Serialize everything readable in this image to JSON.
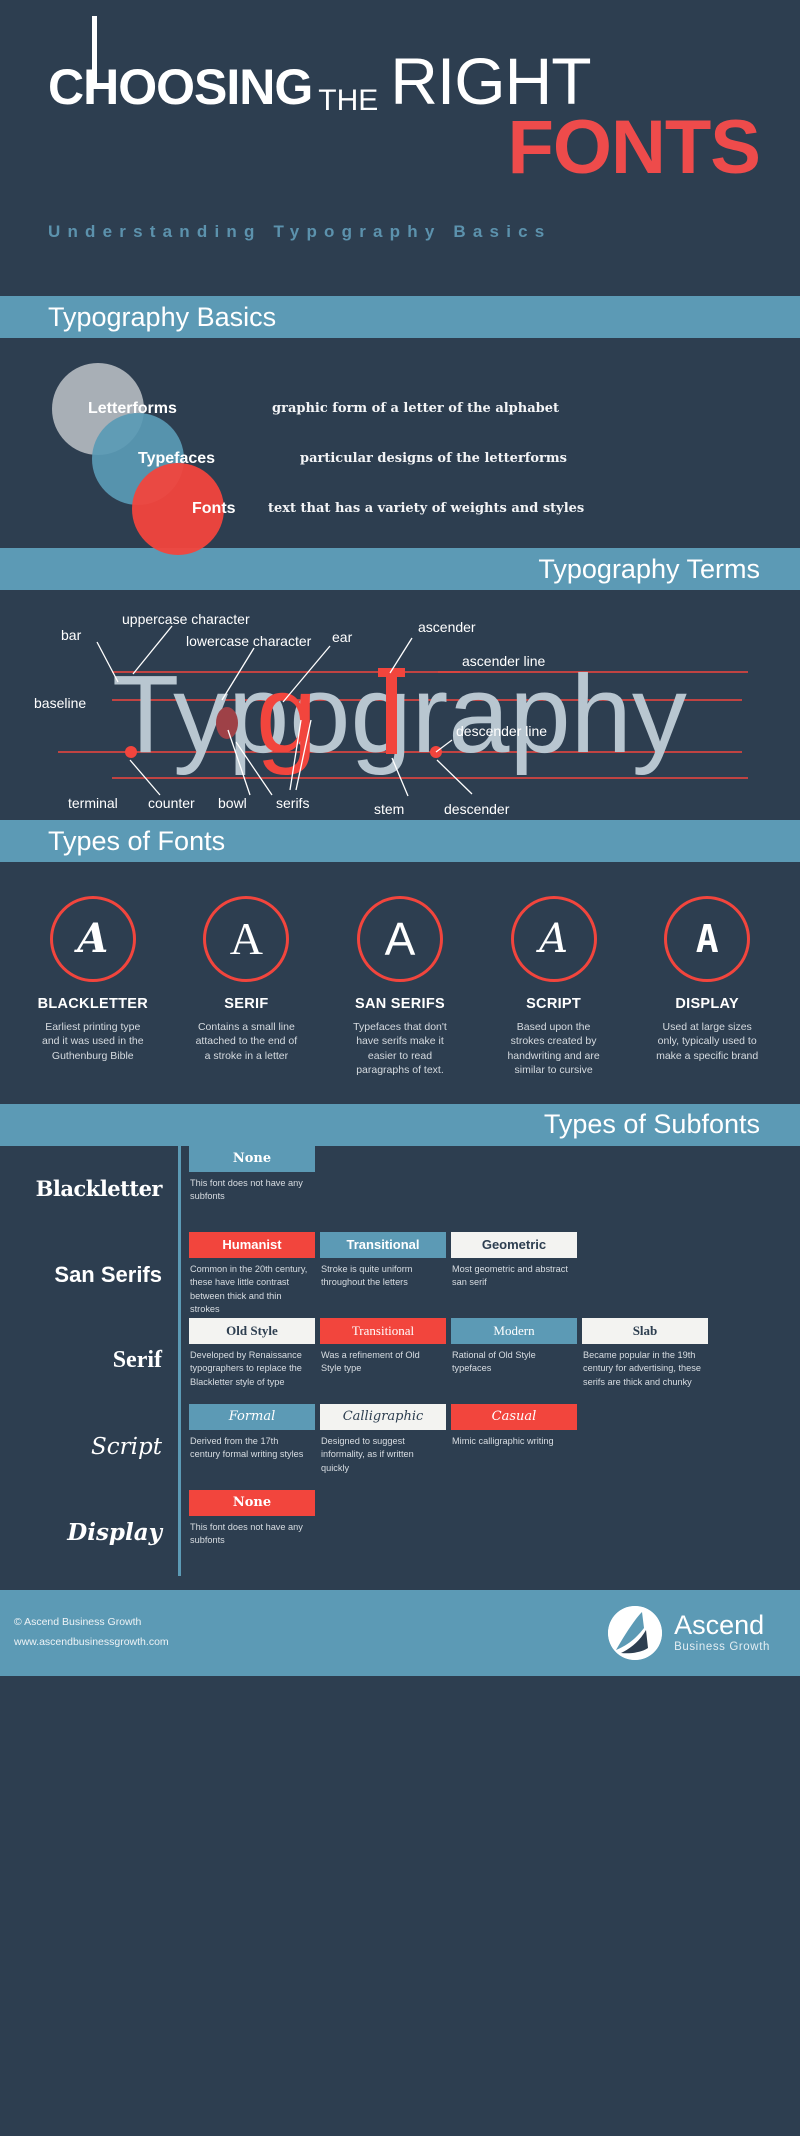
{
  "header": {
    "title_choosing": "CHOOSING",
    "title_the": "THE",
    "title_right": "RIGHT",
    "title_fonts": "FONTS",
    "subtitle": "Understanding Typography Basics"
  },
  "colors": {
    "background": "#2d3e50",
    "bar_blue": "#5c9ab5",
    "accent_red": "#f2453d",
    "letterform_gray": "#b3b8bf",
    "typeface_blue": "#5a9ab5",
    "text_white": "#ffffff",
    "subtitle_blue": "#5c92ad",
    "serif_word_gray": "#b8c6d0"
  },
  "sections": {
    "basics_title": "Typography Basics",
    "terms_title": "Typography Terms",
    "types_title": "Types of Fonts",
    "subfonts_title": "Types of Subfonts"
  },
  "basics": {
    "items": [
      {
        "label": "Letterforms",
        "desc": "graphic form of a letter of the alphabet",
        "color": "#b3b8bf"
      },
      {
        "label": "Typefaces",
        "desc": "particular designs of the letterforms",
        "color": "#5a9ab5"
      },
      {
        "label": "Fonts",
        "desc": "text that has a variety of weights and styles",
        "color": "#f2453d"
      }
    ]
  },
  "terms": {
    "word": "Typography",
    "labels": {
      "bar": "bar",
      "uppercase": "uppercase character",
      "lowercase": "lowercase character",
      "ear": "ear",
      "ascender": "ascender",
      "ascender_line": "ascender line",
      "baseline": "baseline",
      "descender_line": "descender line",
      "terminal": "terminal",
      "counter": "counter",
      "bowl": "bowl",
      "serifs": "serifs",
      "stem": "stem",
      "descender": "descender"
    }
  },
  "font_types": [
    {
      "glyph": "A",
      "style": "blackletter",
      "name": "BLACKLETTER",
      "desc": "Earliest printing type and it was used in the Guthenburg Bible"
    },
    {
      "glyph": "A",
      "style": "serif",
      "name": "SERIF",
      "desc": "Contains a small line attached to the end of a stroke in a letter"
    },
    {
      "glyph": "A",
      "style": "sans",
      "name": "SAN SERIFS",
      "desc": "Typefaces that don't have serifs make it easier to read paragraphs of text."
    },
    {
      "glyph": "A",
      "style": "script",
      "name": "SCRIPT",
      "desc": "Based upon the strokes created by handwriting and are similar to cursive"
    },
    {
      "glyph": "A",
      "style": "display",
      "name": "DISPLAY",
      "desc": "Used at large sizes only, typically used to make a specific brand"
    }
  ],
  "subfonts": [
    {
      "family": "Blackletter",
      "family_style": "blackletter",
      "cells": [
        {
          "label": "None",
          "chip": "blue",
          "chip_font": "black",
          "desc": "This font does not have any subfonts"
        }
      ]
    },
    {
      "family": "San Serifs",
      "family_style": "sans",
      "cells": [
        {
          "label": "Humanist",
          "chip": "red",
          "chip_font": "sans",
          "desc": "Common in the 20th century, these have little contrast between thick and thin strokes"
        },
        {
          "label": "Transitional",
          "chip": "blue",
          "chip_font": "sansb",
          "desc": "Stroke is quite uniform throughout the letters"
        },
        {
          "label": "Geometric",
          "chip": "white",
          "chip_font": "sansb",
          "desc": "Most geometric and abstract san serif"
        }
      ]
    },
    {
      "family": "Serif",
      "family_style": "serif",
      "cells": [
        {
          "label": "Old Style",
          "chip": "white",
          "chip_font": "serifb",
          "desc": "Developed by Renaissance typographers to replace the Blackletter style of type"
        },
        {
          "label": "Transitional",
          "chip": "red",
          "chip_font": "serif",
          "desc": "Was a refinement of Old Style type"
        },
        {
          "label": "Modern",
          "chip": "blue",
          "chip_font": "serif",
          "desc": "Rational of Old Style typefaces"
        },
        {
          "label": "Slab",
          "chip": "white",
          "chip_font": "serifb",
          "desc": "Became popular in the 19th century for advertising, these serifs are thick and chunky"
        }
      ]
    },
    {
      "family": "Script",
      "family_style": "script",
      "cells": [
        {
          "label": "Formal",
          "chip": "blue",
          "chip_font": "script",
          "desc": "Derived from the 17th century formal writing styles"
        },
        {
          "label": "Calligraphic",
          "chip": "white",
          "chip_font": "script",
          "desc": "Designed to suggest informality, as if written quickly"
        },
        {
          "label": "Casual",
          "chip": "red",
          "chip_font": "script",
          "desc": "Mimic calligraphic writing"
        }
      ]
    },
    {
      "family": "Display",
      "family_style": "display",
      "cells": [
        {
          "label": "None",
          "chip": "red",
          "chip_font": "black",
          "desc": "This font does not have any subfonts"
        }
      ]
    }
  ],
  "footer": {
    "copyright": "© Ascend Business Growth",
    "website": "www.ascendbusinessgrowth.com",
    "brand_name": "Ascend",
    "brand_tagline": "Business Growth"
  }
}
